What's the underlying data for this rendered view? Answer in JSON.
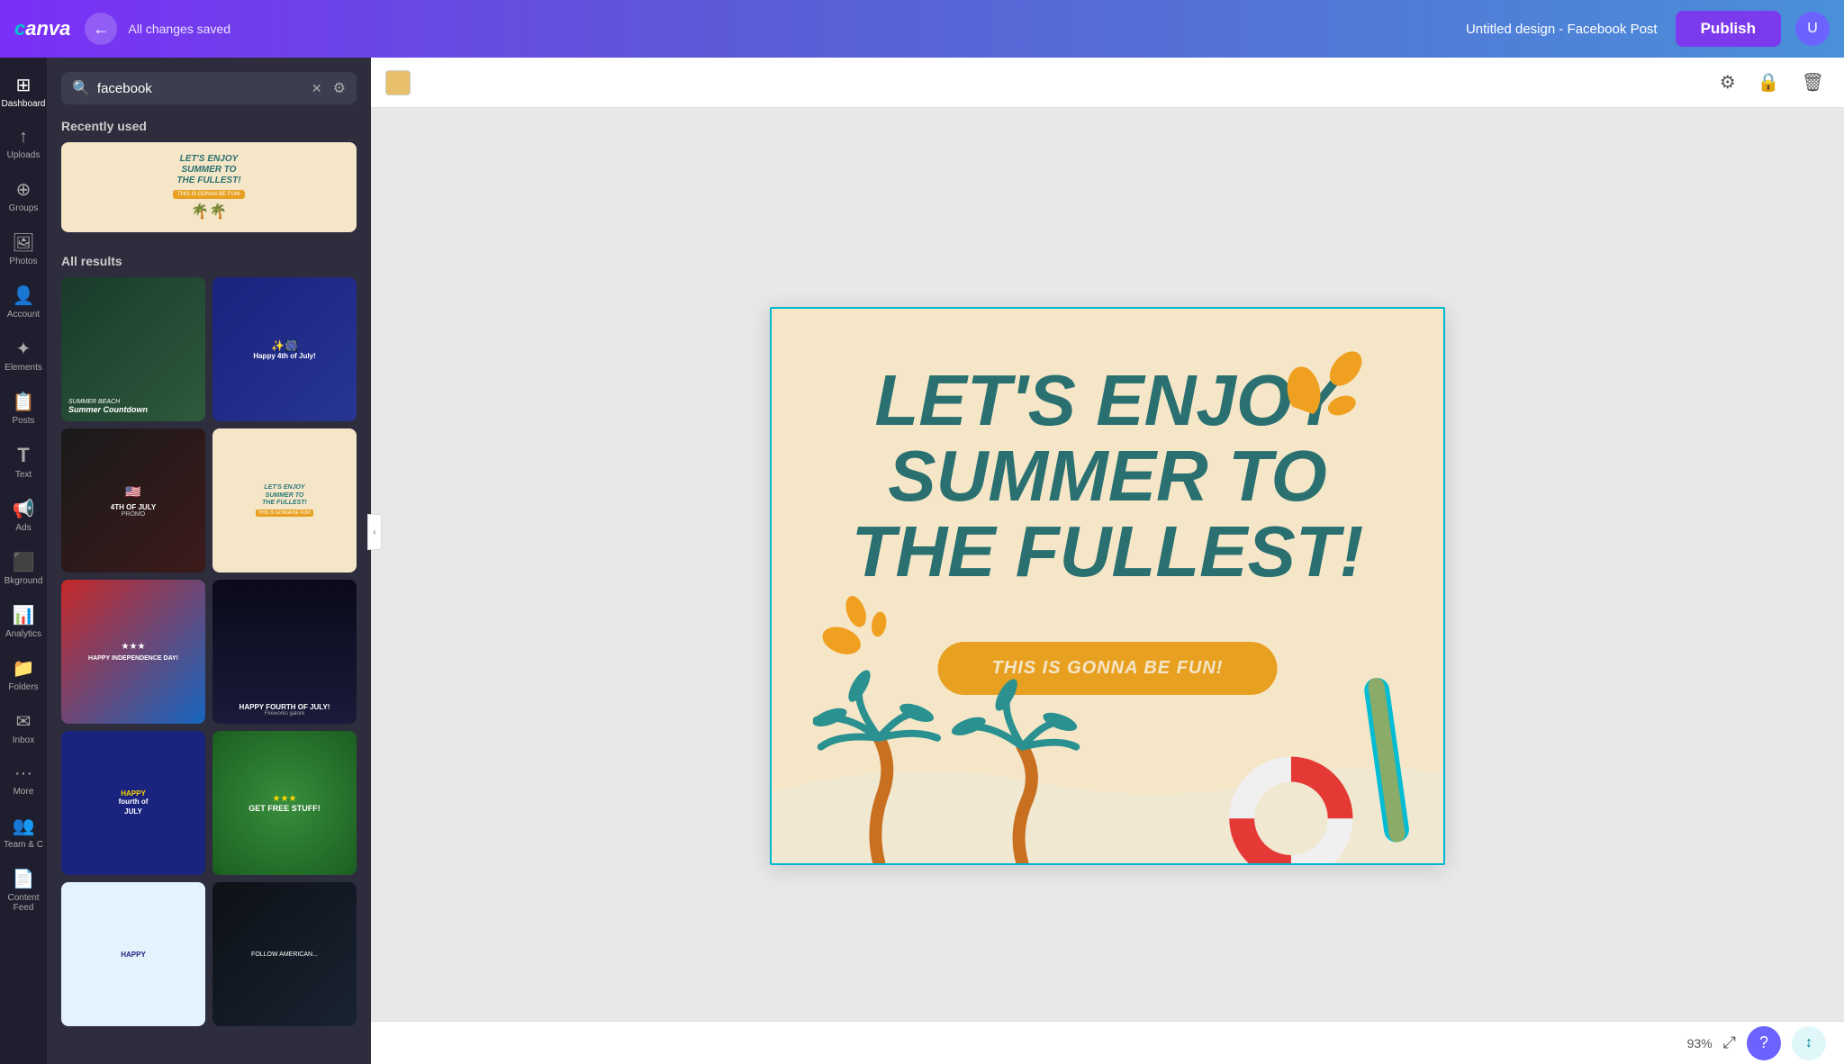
{
  "topbar": {
    "logo": "Canva",
    "back_label": "←",
    "saved_text": "All changes saved",
    "design_title": "Untitled design - Facebook Post",
    "publish_label": "Publish",
    "avatar_initial": "U"
  },
  "leftnav": {
    "items": [
      {
        "id": "dashboard",
        "label": "Dashboard",
        "icon": "⊞"
      },
      {
        "id": "uploads",
        "label": "Uploads",
        "icon": "↑"
      },
      {
        "id": "groups",
        "label": "Groups",
        "icon": "⊕"
      },
      {
        "id": "photos",
        "label": "Photos",
        "icon": "🖼"
      },
      {
        "id": "account",
        "label": "Account",
        "icon": "👤"
      },
      {
        "id": "elements",
        "label": "Elements",
        "icon": "✦"
      },
      {
        "id": "posts",
        "label": "Posts",
        "icon": "📋"
      },
      {
        "id": "text",
        "label": "Text",
        "icon": "T"
      },
      {
        "id": "ads",
        "label": "Ads",
        "icon": "📢"
      },
      {
        "id": "bkground",
        "label": "Bkground",
        "icon": "🖼"
      },
      {
        "id": "analytics",
        "label": "Analytics",
        "icon": "📊"
      },
      {
        "id": "folders",
        "label": "Folders",
        "icon": "📁"
      },
      {
        "id": "inbox",
        "label": "Inbox",
        "icon": "✉"
      },
      {
        "id": "more",
        "label": "More",
        "icon": "···"
      },
      {
        "id": "team",
        "label": "Team & C",
        "icon": "👥"
      },
      {
        "id": "content",
        "label": "Content Feed",
        "icon": "📄"
      }
    ]
  },
  "sidebar": {
    "search_placeholder": "facebook",
    "search_value": "facebook",
    "recently_used_label": "Recently used",
    "all_results_label": "All results",
    "templates": [
      {
        "id": "summer1",
        "type": "summer",
        "headline": "LET'S ENJOY SUMMER TO THE FULLEST!",
        "sub": "THIS IS GONNA BE FUN!",
        "bg": "#f5e6c8"
      },
      {
        "id": "countdown",
        "type": "countdown",
        "title": "Summer Countdown",
        "bg": "#1a3a2a"
      },
      {
        "id": "4july",
        "type": "4july",
        "title": "Happy 4th of July!",
        "bg": "#1a237e"
      },
      {
        "id": "promo",
        "type": "promo",
        "title": "4TH OF JULY PROMO",
        "bg": "#1a1a1a"
      },
      {
        "id": "summer2",
        "type": "summer2",
        "headline": "LET'S ENJOY SUMMER TO THE FULLEST!",
        "sub": "THIS IS GONNA BE FUN!",
        "bg": "#f5e6c8"
      },
      {
        "id": "independence",
        "type": "independence",
        "title": "HAPPY INDEPENDENCE DAY!",
        "bg": "#c62828"
      },
      {
        "id": "fireworks",
        "type": "fireworks",
        "title": "HAPPY FOURTH OF JULY!",
        "sub": "Fireworks galore",
        "bg": "#0a0a1a"
      },
      {
        "id": "hapfourth",
        "type": "hapfourth",
        "title": "HAPPY fourth of JULY",
        "bg": "#1a237e"
      },
      {
        "id": "getfree",
        "type": "getfree",
        "title": "GET FREE STUFF!",
        "bg": "#388e3c"
      },
      {
        "id": "happy2a",
        "type": "happy2",
        "title": "HAPPY",
        "bg": "#e3f2fd"
      },
      {
        "id": "dark1",
        "type": "dark",
        "title": "FOLLOW AMERICAN...",
        "bg": "#0d1117"
      }
    ]
  },
  "canvas": {
    "headline_line1": "LET'S ENJOY",
    "headline_line2": "SUMMER TO",
    "headline_line3": "THE FULLEST!",
    "button_text": "THIS IS GONNA BE FUN!",
    "bg_color": "#f5e6c8",
    "text_color": "#2a7070",
    "button_color": "#e8a020"
  },
  "toolbar": {
    "color_swatch": "#e8c06c",
    "icons": [
      "filter",
      "lock",
      "trash"
    ]
  },
  "bottombar": {
    "zoom_level": "93%",
    "help_icon": "?",
    "expand_icon": "⤢"
  }
}
